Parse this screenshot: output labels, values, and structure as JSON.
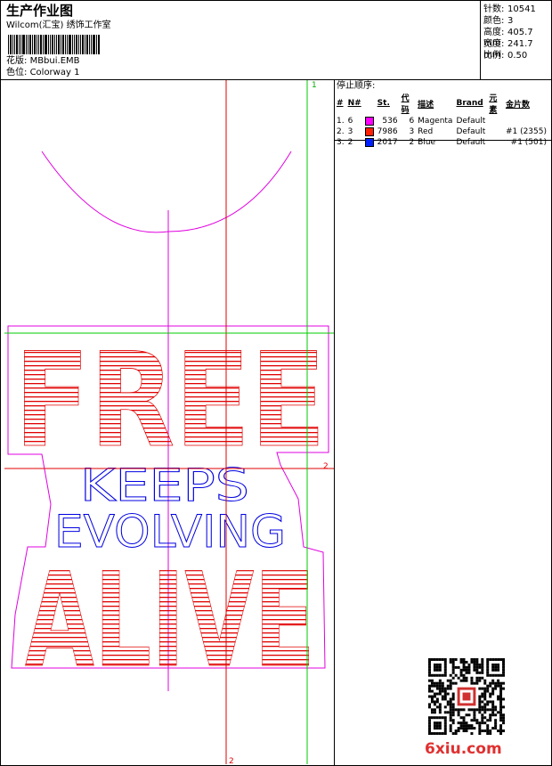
{
  "header": {
    "title": "生产作业图",
    "company": "Wilcom(汇宝) 绣饰工作室",
    "design_label": "花版:",
    "design_value": "MBbui.EMB",
    "colorway_label": "色位:",
    "colorway_value": "Colorway 1"
  },
  "stats": [
    {
      "label": "针数:",
      "value": "10541"
    },
    {
      "label": "颜色:",
      "value": "3"
    },
    {
      "label": "高度:",
      "value": "405.7 mm"
    },
    {
      "label": "宽度:",
      "value": "241.7 mm"
    },
    {
      "label": "比例:",
      "value": "0.50"
    }
  ],
  "stop_sequence": {
    "title": "停止顺序:",
    "headers": [
      "#",
      "N#",
      "St.",
      "代码",
      "描述",
      "Brand",
      "元素",
      "金片数"
    ],
    "rows": [
      {
        "idx": "1.",
        "n": "6",
        "color": "#ff00ff",
        "st": "536",
        "code": "6",
        "desc": "Magenta",
        "brand": "Default",
        "element": "",
        "sequin": ""
      },
      {
        "idx": "2.",
        "n": "3",
        "color": "#ff2000",
        "st": "7986",
        "code": "3",
        "desc": "Red",
        "brand": "Default",
        "element": "",
        "sequin": "#1 (2355)"
      },
      {
        "idx": "3.",
        "n": "2",
        "color": "#0020ff",
        "st": "2017",
        "code": "2",
        "desc": "Blue",
        "brand": "Default",
        "element": "",
        "sequin": "#1 (501)"
      }
    ]
  },
  "design": {
    "top_text": "FREE",
    "middle_line1": "KEEPS",
    "middle_line2": "EVOLVING",
    "bottom_text": "ALIVE",
    "guide_marks": [
      "1",
      "2",
      "2"
    ],
    "colors": {
      "magenta": "#e000e0",
      "red": "#e00000",
      "blue": "#0000e0",
      "green": "#00cc00"
    }
  },
  "watermark": "6xiu.com"
}
